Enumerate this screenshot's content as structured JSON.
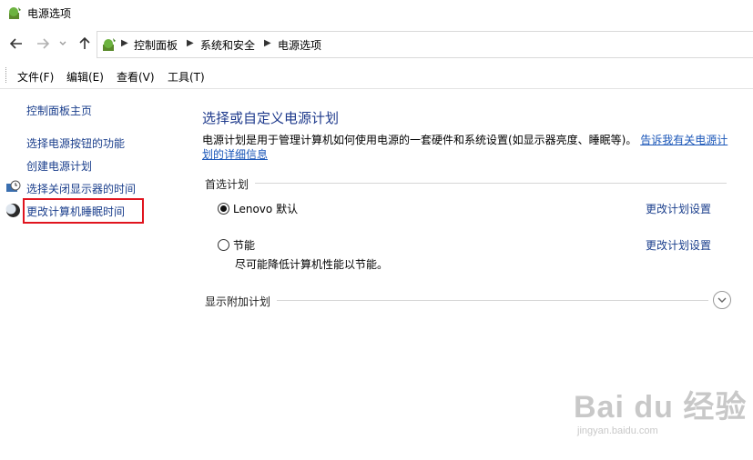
{
  "window": {
    "title": "电源选项"
  },
  "nav": {
    "breadcrumb": [
      "控制面板",
      "系统和安全",
      "电源选项"
    ]
  },
  "menu": [
    "文件(F)",
    "编辑(E)",
    "查看(V)",
    "工具(T)"
  ],
  "sidebar": {
    "home": "控制面板主页",
    "links": [
      "选择电源按钮的功能",
      "创建电源计划",
      "选择关闭显示器的时间",
      "更改计算机睡眠时间"
    ]
  },
  "main": {
    "title": "选择或自定义电源计划",
    "description": "电源计划是用于管理计算机如何使用电源的一套硬件和系统设置(如显示器亮度、睡眠等)。",
    "description_link": "告诉我有关电源计划的详细信息",
    "preferred_label": "首选计划",
    "plans": [
      {
        "name": "Lenovo 默认",
        "selected": true,
        "link": "更改计划设置",
        "desc": ""
      },
      {
        "name": "节能",
        "selected": false,
        "link": "更改计划设置",
        "desc": "尽可能降低计算机性能以节能。"
      }
    ],
    "additional_label": "显示附加计划"
  },
  "watermark": {
    "main": "Bai du 经验",
    "sub": "jingyan.baidu.com"
  },
  "colors": {
    "link": "#1a3e8c",
    "title": "#1e3a8c",
    "highlight": "#e0141e"
  }
}
